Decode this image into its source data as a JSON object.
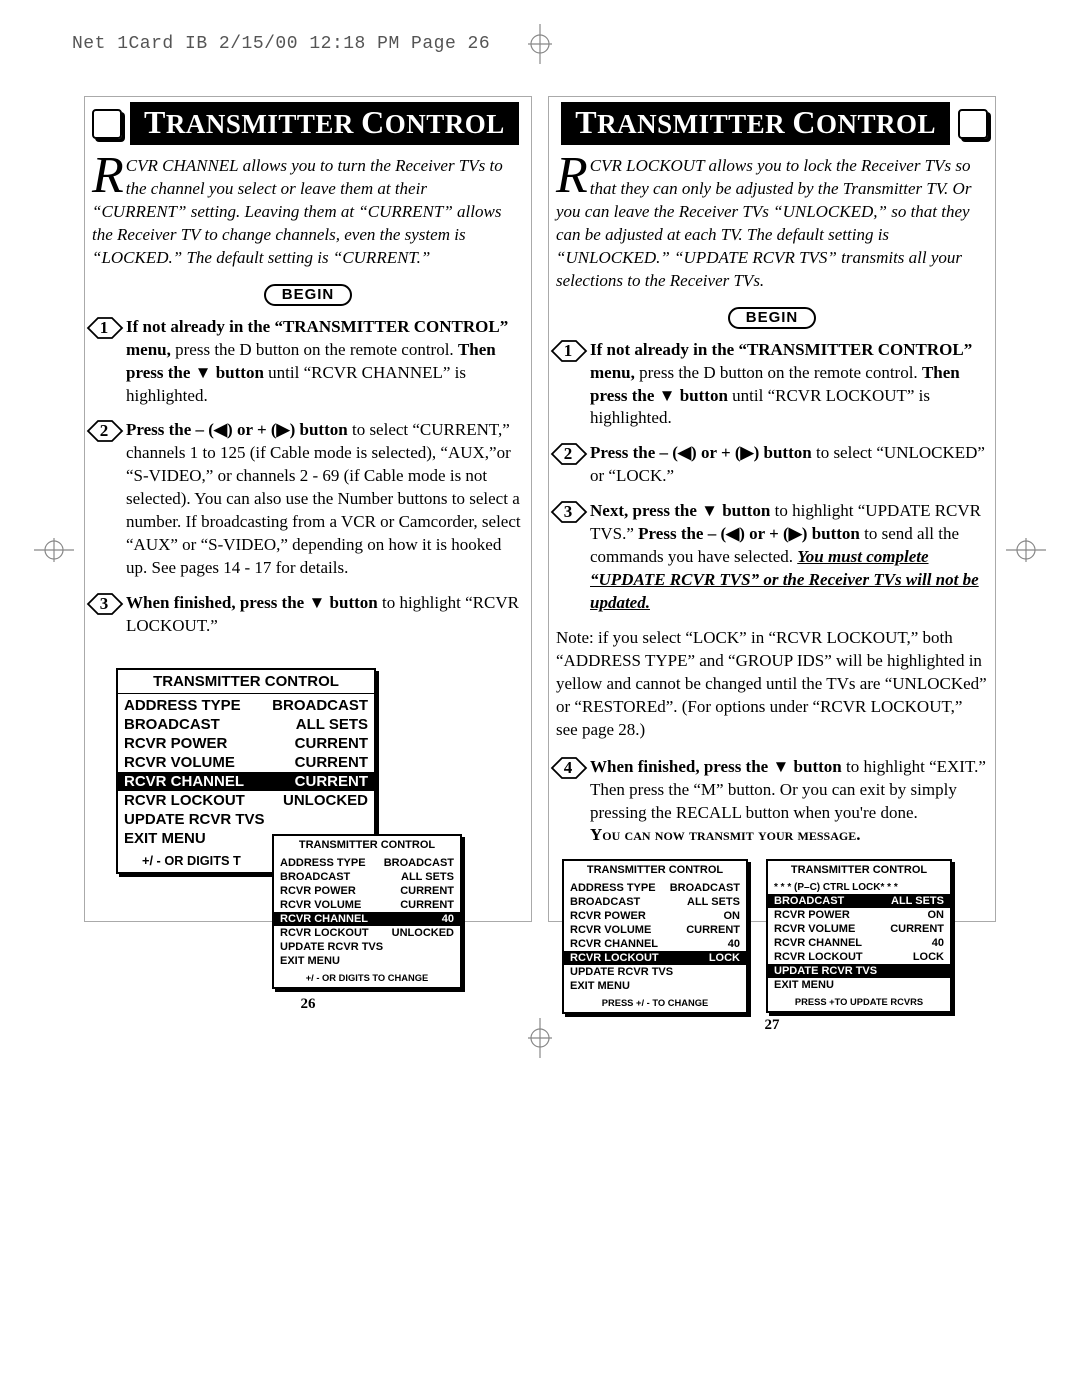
{
  "header": "Net 1Card IB  2/15/00 12:18 PM  Page 26",
  "title": "TRANSMITTER CONTROL",
  "begin_label": "BEGIN",
  "left": {
    "intro": "CVR CHANNEL allows you to turn the Receiver TVs to the channel you select or leave them at their “CURRENT” setting. Leaving them at “CURRENT” allows the Receiver TV to change channels, even the system is “LOCKED.” The default setting is “CURRENT.”",
    "steps": {
      "s1a": "If not already in the “TRANSMITTER CONTROL” menu,",
      "s1b": " press the D button on the remote control. ",
      "s1c": "Then press the ▼ button",
      "s1d": " until “RCVR CHANNEL” is highlighted.",
      "s2a": "Press the – (◀) or + (▶) button",
      "s2b": " to select “CURRENT,” channels 1 to 125 (if Cable mode is selected), “AUX,”or “S-VIDEO,” or channels 2 - 69 (if Cable mode is not selected). You can also use the Number buttons to select a number. If broadcasting from a VCR or Camcorder, select “AUX” or “S-VIDEO,” depending on how it is hooked up. See pages 14 - 17 for details.",
      "s3a": "When finished, press the ▼ button",
      "s3b": " to highlight “RCVR LOCKOUT.”"
    },
    "pagenum": "26"
  },
  "right": {
    "intro": "CVR LOCKOUT allows you to lock the Receiver TVs so that they can only be adjusted by the Transmitter TV. Or you can leave the Receiver TVs “UNLOCKED,” so that they can be adjusted at each TV. The default setting is “UNLOCKED.” “UPDATE RCVR TVS” transmits all your selections to the Receiver TVs.",
    "steps": {
      "s1a": "If not already in the “TRANSMITTER CONTROL” menu,",
      "s1b": " press the D button on the remote control. ",
      "s1c": "Then press the ▼ button",
      "s1d": " until “RCVR LOCKOUT” is highlighted.",
      "s2a": "Press the – (◀) or + (▶) button",
      "s2b": " to select “UNLOCKED” or “LOCK.”",
      "s3a": "Next, press the ▼ button",
      "s3b": " to highlight “UPDATE RCVR TVS.” ",
      "s3c": "Press the – (◀) or + (▶) button",
      "s3d": " to send all the commands you have selected. ",
      "s3e": "You must complete “UPDATE RCVR TVS” or the Receiver TVs will not be updated.",
      "note": "Note: if you select “LOCK” in “RCVR LOCKOUT,” both “ADDRESS TYPE” and “GROUP IDS” will be highlighted in yellow and cannot be changed until the TVs are “UNLOCKed” or “RESTOREd”. (For options under “RCVR LOCKOUT,” see page 28.)",
      "s4a": "When finished, press the ▼ button",
      "s4b": " to highlight “EXIT.” Then press the “M” button. Or you can exit by simply pressing the RECALL button when you're done.",
      "s4c": "You can now transmit your message."
    },
    "pagenum": "27"
  },
  "menu_title": "TRANSMITTER CONTROL",
  "menu_labels": {
    "address_type": "ADDRESS TYPE",
    "broadcast": "BROADCAST",
    "rcvr_power": "RCVR POWER",
    "rcvr_volume": "RCVR VOLUME",
    "rcvr_channel": "RCVR CHANNEL",
    "rcvr_lockout": "RCVR LOCKOUT",
    "update": "UPDATE RCVR TVS",
    "exit": "EXIT MENU"
  },
  "menu_vals": {
    "broadcast": "BROADCAST",
    "all_sets": "ALL SETS",
    "current": "CURRENT",
    "on": "ON",
    "ch40": "40",
    "unlocked": "UNLOCKED",
    "lock": "LOCK"
  },
  "menu_footers": {
    "digits_long": "+/ - OR DIGITS TO CHANGE",
    "digits_trunc": "+/ - OR DIGITS T",
    "press_change": "PRESS +/ - TO CHANGE",
    "press_update": "PRESS +TO UPDATE RCVRS",
    "ctrl_lock": "* * *  (P–C)      CTRL LOCK* * *"
  }
}
